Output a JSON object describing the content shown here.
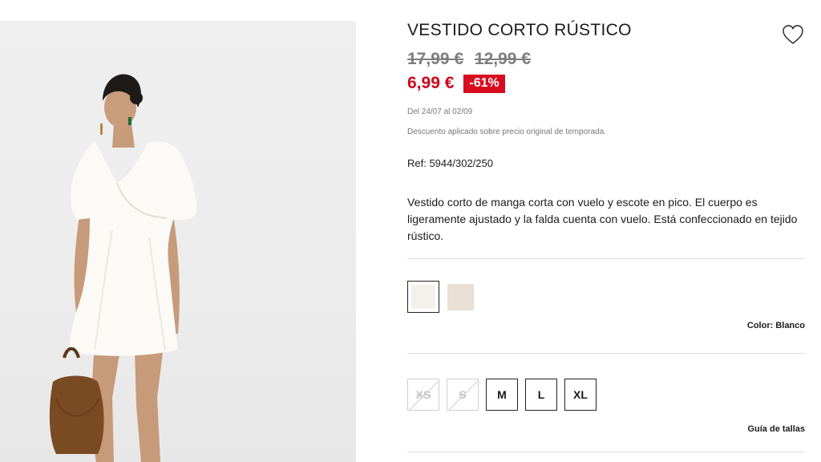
{
  "product": {
    "title": "VESTIDO CORTO RÚSTICO",
    "old_prices": [
      "17,99 €",
      "12,99 €"
    ],
    "price": "6,99 €",
    "discount_badge": "-61%",
    "dates": "Del 24/07 al 02/09",
    "discount_note": "Descuento aplicado sobre precio original de temporada.",
    "reference": "Ref: 5944/302/250",
    "description": "Vestido corto de manga corta con vuelo y escote en pico. El cuerpo es ligeramente ajustado y la falda cuenta con vuelo. Está confeccionado en tejido rústico."
  },
  "colors": {
    "label": "Color: Blanco",
    "swatches": [
      {
        "name": "Blanco",
        "hex": "#f4f1ea",
        "selected": true
      },
      {
        "name": "Beige",
        "hex": "#e9dfd5",
        "selected": false
      }
    ]
  },
  "sizes": {
    "options": [
      {
        "label": "XS",
        "available": false
      },
      {
        "label": "S",
        "available": false
      },
      {
        "label": "M",
        "available": true
      },
      {
        "label": "L",
        "available": true
      },
      {
        "label": "XL",
        "available": true
      }
    ],
    "guide_label": "Guía de tallas"
  },
  "icons": {
    "favorite": "heart-outline-icon"
  },
  "theme": {
    "sale_red": "#d0021b",
    "old_price_gray": "#7d7d7d",
    "photo_background": "#ececec"
  }
}
